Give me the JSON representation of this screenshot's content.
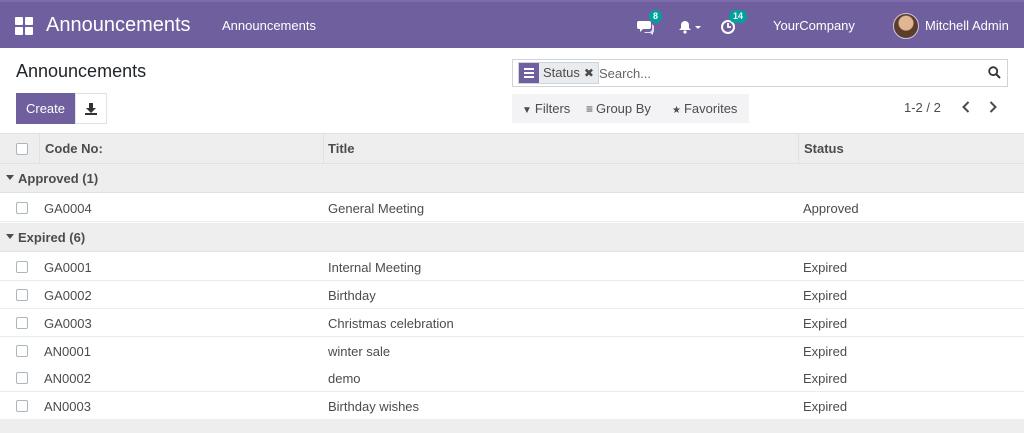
{
  "navbar": {
    "app_title": "Announcements",
    "menu_item": "Announcements",
    "messages_count": "8",
    "activities_count": "14",
    "company": "YourCompany",
    "user_name": "Mitchell Admin"
  },
  "control_panel": {
    "title": "Announcements",
    "create_label": "Create",
    "search": {
      "facet_label": "Status",
      "placeholder": "Search..."
    },
    "filters_label": "Filters",
    "group_by_label": "Group By",
    "favorites_label": "Favorites",
    "pager_value": "1-2 / 2"
  },
  "table": {
    "columns": [
      "Code No:",
      "Title",
      "Status"
    ],
    "groups": [
      {
        "label": "Approved (1)",
        "rows": [
          {
            "code": "GA0004",
            "title": "General Meeting",
            "status": "Approved"
          }
        ]
      },
      {
        "label": "Expired (6)",
        "rows": [
          {
            "code": "GA0001",
            "title": "Internal Meeting",
            "status": "Expired"
          },
          {
            "code": "GA0002",
            "title": "Birthday",
            "status": "Expired"
          },
          {
            "code": "GA0003",
            "title": "Christmas celebration",
            "status": "Expired"
          },
          {
            "code": "AN0001",
            "title": "winter sale",
            "status": "Expired"
          },
          {
            "code": "AN0002",
            "title": "demo",
            "status": "Expired"
          },
          {
            "code": "AN0003",
            "title": "Birthday wishes",
            "status": "Expired"
          }
        ]
      }
    ]
  },
  "colors": {
    "brand": "#6f5f9e",
    "badge": "#00a09d"
  }
}
